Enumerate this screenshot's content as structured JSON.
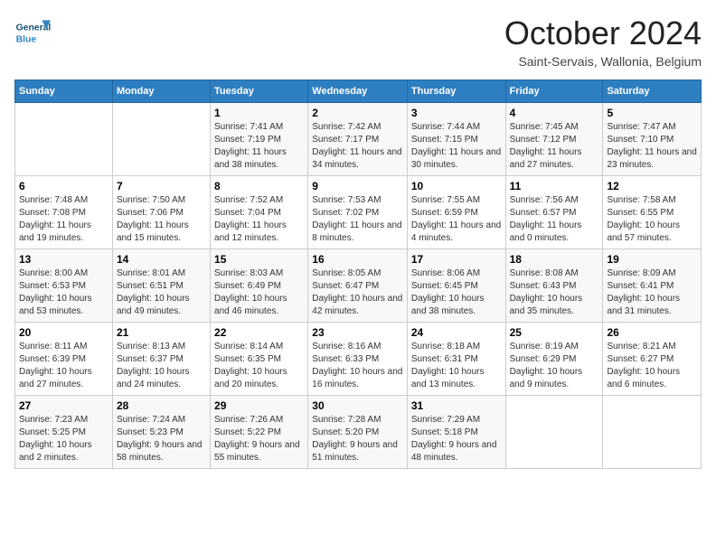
{
  "header": {
    "logo_general": "General",
    "logo_blue": "Blue",
    "month_title": "October 2024",
    "location": "Saint-Servais, Wallonia, Belgium"
  },
  "days_of_week": [
    "Sunday",
    "Monday",
    "Tuesday",
    "Wednesday",
    "Thursday",
    "Friday",
    "Saturday"
  ],
  "weeks": [
    [
      {
        "day": "",
        "sunrise": "",
        "sunset": "",
        "daylight": ""
      },
      {
        "day": "",
        "sunrise": "",
        "sunset": "",
        "daylight": ""
      },
      {
        "day": "1",
        "sunrise": "Sunrise: 7:41 AM",
        "sunset": "Sunset: 7:19 PM",
        "daylight": "Daylight: 11 hours and 38 minutes."
      },
      {
        "day": "2",
        "sunrise": "Sunrise: 7:42 AM",
        "sunset": "Sunset: 7:17 PM",
        "daylight": "Daylight: 11 hours and 34 minutes."
      },
      {
        "day": "3",
        "sunrise": "Sunrise: 7:44 AM",
        "sunset": "Sunset: 7:15 PM",
        "daylight": "Daylight: 11 hours and 30 minutes."
      },
      {
        "day": "4",
        "sunrise": "Sunrise: 7:45 AM",
        "sunset": "Sunset: 7:12 PM",
        "daylight": "Daylight: 11 hours and 27 minutes."
      },
      {
        "day": "5",
        "sunrise": "Sunrise: 7:47 AM",
        "sunset": "Sunset: 7:10 PM",
        "daylight": "Daylight: 11 hours and 23 minutes."
      }
    ],
    [
      {
        "day": "6",
        "sunrise": "Sunrise: 7:48 AM",
        "sunset": "Sunset: 7:08 PM",
        "daylight": "Daylight: 11 hours and 19 minutes."
      },
      {
        "day": "7",
        "sunrise": "Sunrise: 7:50 AM",
        "sunset": "Sunset: 7:06 PM",
        "daylight": "Daylight: 11 hours and 15 minutes."
      },
      {
        "day": "8",
        "sunrise": "Sunrise: 7:52 AM",
        "sunset": "Sunset: 7:04 PM",
        "daylight": "Daylight: 11 hours and 12 minutes."
      },
      {
        "day": "9",
        "sunrise": "Sunrise: 7:53 AM",
        "sunset": "Sunset: 7:02 PM",
        "daylight": "Daylight: 11 hours and 8 minutes."
      },
      {
        "day": "10",
        "sunrise": "Sunrise: 7:55 AM",
        "sunset": "Sunset: 6:59 PM",
        "daylight": "Daylight: 11 hours and 4 minutes."
      },
      {
        "day": "11",
        "sunrise": "Sunrise: 7:56 AM",
        "sunset": "Sunset: 6:57 PM",
        "daylight": "Daylight: 11 hours and 0 minutes."
      },
      {
        "day": "12",
        "sunrise": "Sunrise: 7:58 AM",
        "sunset": "Sunset: 6:55 PM",
        "daylight": "Daylight: 10 hours and 57 minutes."
      }
    ],
    [
      {
        "day": "13",
        "sunrise": "Sunrise: 8:00 AM",
        "sunset": "Sunset: 6:53 PM",
        "daylight": "Daylight: 10 hours and 53 minutes."
      },
      {
        "day": "14",
        "sunrise": "Sunrise: 8:01 AM",
        "sunset": "Sunset: 6:51 PM",
        "daylight": "Daylight: 10 hours and 49 minutes."
      },
      {
        "day": "15",
        "sunrise": "Sunrise: 8:03 AM",
        "sunset": "Sunset: 6:49 PM",
        "daylight": "Daylight: 10 hours and 46 minutes."
      },
      {
        "day": "16",
        "sunrise": "Sunrise: 8:05 AM",
        "sunset": "Sunset: 6:47 PM",
        "daylight": "Daylight: 10 hours and 42 minutes."
      },
      {
        "day": "17",
        "sunrise": "Sunrise: 8:06 AM",
        "sunset": "Sunset: 6:45 PM",
        "daylight": "Daylight: 10 hours and 38 minutes."
      },
      {
        "day": "18",
        "sunrise": "Sunrise: 8:08 AM",
        "sunset": "Sunset: 6:43 PM",
        "daylight": "Daylight: 10 hours and 35 minutes."
      },
      {
        "day": "19",
        "sunrise": "Sunrise: 8:09 AM",
        "sunset": "Sunset: 6:41 PM",
        "daylight": "Daylight: 10 hours and 31 minutes."
      }
    ],
    [
      {
        "day": "20",
        "sunrise": "Sunrise: 8:11 AM",
        "sunset": "Sunset: 6:39 PM",
        "daylight": "Daylight: 10 hours and 27 minutes."
      },
      {
        "day": "21",
        "sunrise": "Sunrise: 8:13 AM",
        "sunset": "Sunset: 6:37 PM",
        "daylight": "Daylight: 10 hours and 24 minutes."
      },
      {
        "day": "22",
        "sunrise": "Sunrise: 8:14 AM",
        "sunset": "Sunset: 6:35 PM",
        "daylight": "Daylight: 10 hours and 20 minutes."
      },
      {
        "day": "23",
        "sunrise": "Sunrise: 8:16 AM",
        "sunset": "Sunset: 6:33 PM",
        "daylight": "Daylight: 10 hours and 16 minutes."
      },
      {
        "day": "24",
        "sunrise": "Sunrise: 8:18 AM",
        "sunset": "Sunset: 6:31 PM",
        "daylight": "Daylight: 10 hours and 13 minutes."
      },
      {
        "day": "25",
        "sunrise": "Sunrise: 8:19 AM",
        "sunset": "Sunset: 6:29 PM",
        "daylight": "Daylight: 10 hours and 9 minutes."
      },
      {
        "day": "26",
        "sunrise": "Sunrise: 8:21 AM",
        "sunset": "Sunset: 6:27 PM",
        "daylight": "Daylight: 10 hours and 6 minutes."
      }
    ],
    [
      {
        "day": "27",
        "sunrise": "Sunrise: 7:23 AM",
        "sunset": "Sunset: 5:25 PM",
        "daylight": "Daylight: 10 hours and 2 minutes."
      },
      {
        "day": "28",
        "sunrise": "Sunrise: 7:24 AM",
        "sunset": "Sunset: 5:23 PM",
        "daylight": "Daylight: 9 hours and 58 minutes."
      },
      {
        "day": "29",
        "sunrise": "Sunrise: 7:26 AM",
        "sunset": "Sunset: 5:22 PM",
        "daylight": "Daylight: 9 hours and 55 minutes."
      },
      {
        "day": "30",
        "sunrise": "Sunrise: 7:28 AM",
        "sunset": "Sunset: 5:20 PM",
        "daylight": "Daylight: 9 hours and 51 minutes."
      },
      {
        "day": "31",
        "sunrise": "Sunrise: 7:29 AM",
        "sunset": "Sunset: 5:18 PM",
        "daylight": "Daylight: 9 hours and 48 minutes."
      },
      {
        "day": "",
        "sunrise": "",
        "sunset": "",
        "daylight": ""
      },
      {
        "day": "",
        "sunrise": "",
        "sunset": "",
        "daylight": ""
      }
    ]
  ]
}
